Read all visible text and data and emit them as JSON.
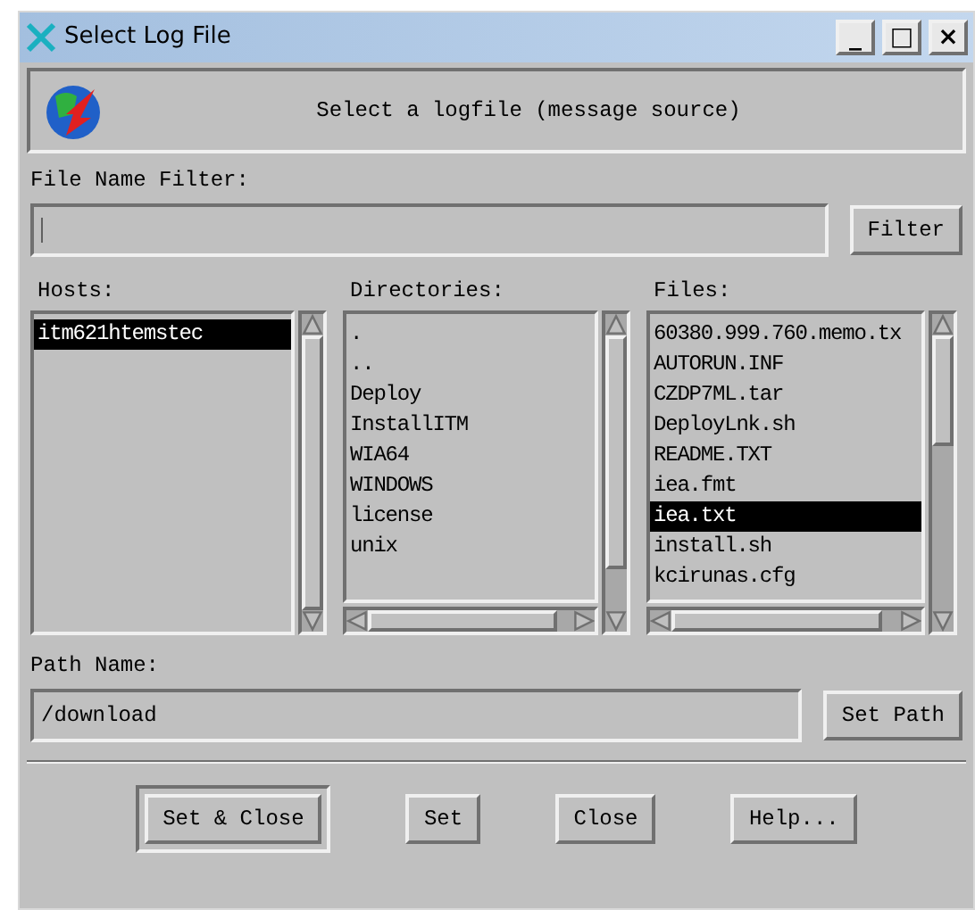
{
  "window": {
    "title": "Select Log File",
    "controls": [
      "_",
      "□",
      "×"
    ]
  },
  "header": {
    "message": "Select a logfile (message source)"
  },
  "filter": {
    "label": "File Name Filter:",
    "button": "Filter"
  },
  "lists": [
    {
      "label": "Hosts:",
      "items": [
        {
          "text": "itm621htemstec",
          "selected": true
        }
      ]
    },
    {
      "label": "Directories:",
      "items": [
        {
          "text": ".",
          "selected": false
        },
        {
          "text": "..",
          "selected": false
        },
        {
          "text": "Deploy",
          "selected": false
        },
        {
          "text": "InstallITM",
          "selected": false
        },
        {
          "text": "WIA64",
          "selected": false
        },
        {
          "text": "WINDOWS",
          "selected": false
        },
        {
          "text": "license",
          "selected": false
        },
        {
          "text": "unix",
          "selected": false
        }
      ]
    },
    {
      "label": "Files:",
      "items": [
        {
          "text": "60380.999.760.memo.tx",
          "selected": false
        },
        {
          "text": "AUTORUN.INF",
          "selected": false
        },
        {
          "text": "CZDP7ML.tar",
          "selected": false
        },
        {
          "text": "DeployLnk.sh",
          "selected": false
        },
        {
          "text": "README.TXT",
          "selected": false
        },
        {
          "text": "iea.fmt",
          "selected": false
        },
        {
          "text": "iea.txt",
          "selected": true
        },
        {
          "text": "install.sh",
          "selected": false
        },
        {
          "text": "kcirunas.cfg",
          "selected": false
        }
      ]
    }
  ],
  "path": {
    "label": "Path Name:",
    "value": "/download",
    "button": "Set Path"
  },
  "buttons": [
    {
      "label": "Set & Close",
      "default": true
    },
    {
      "label": "Set",
      "default": false
    },
    {
      "label": "Close",
      "default": false
    },
    {
      "label": "Help...",
      "default": false
    }
  ]
}
